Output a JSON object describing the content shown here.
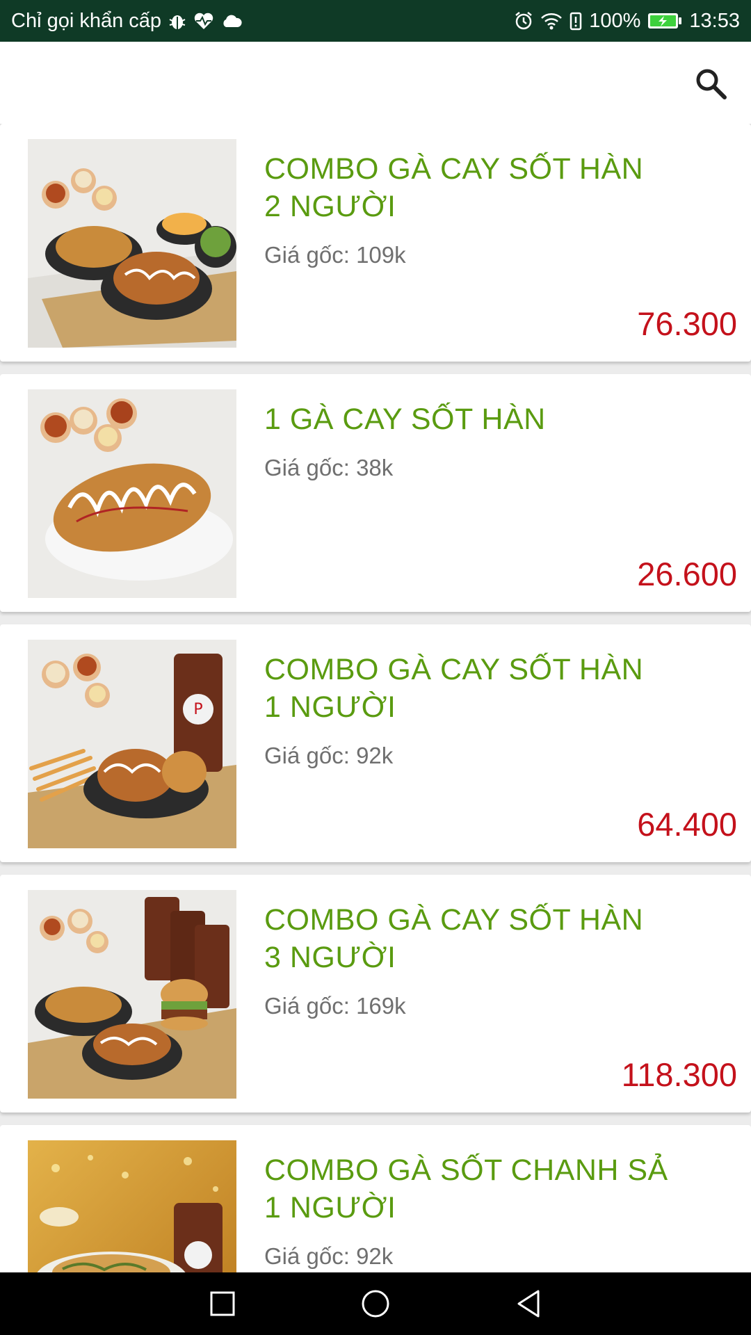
{
  "status_bar": {
    "carrier_text": "Chỉ gọi khẩn cấp",
    "battery": "100%",
    "time": "13:53",
    "icons_left": [
      "bug-icon",
      "heart-monitor-icon",
      "cloud-icon"
    ],
    "icons_right": [
      "alarm-icon",
      "wifi-icon",
      "battery-alert-icon",
      "battery-charging-icon"
    ]
  },
  "toolbar": {
    "search_icon": "search-icon"
  },
  "products": [
    {
      "title": "COMBO GÀ CAY SỐT HÀN\n2 NGƯỜI",
      "original_price": "Giá gốc: 109k",
      "price": "76.300"
    },
    {
      "title": "1 GÀ CAY SỐT HÀN",
      "original_price": "Giá gốc: 38k",
      "price": "26.600"
    },
    {
      "title": "COMBO GÀ CAY SỐT HÀN\n1 NGƯỜI",
      "original_price": "Giá gốc: 92k",
      "price": "64.400"
    },
    {
      "title": "COMBO GÀ CAY SỐT HÀN\n3 NGƯỜI",
      "original_price": "Giá gốc: 169k",
      "price": "118.300"
    },
    {
      "title": "COMBO GÀ SỐT CHANH SẢ\n1 NGƯỜI",
      "original_price": "Giá gốc: 92k",
      "price": ""
    }
  ],
  "colors": {
    "status_bar": "#0f3a26",
    "title_green": "#5a9b10",
    "price_red": "#c4111b",
    "original_gray": "#6f6f6f"
  },
  "nav_bar": {
    "buttons": [
      "recent-apps-icon",
      "home-icon",
      "back-icon"
    ]
  }
}
